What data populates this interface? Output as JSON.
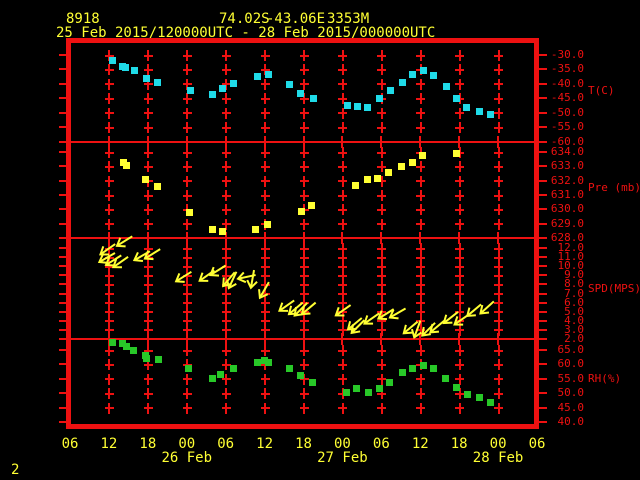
{
  "header": {
    "station_id": "8918",
    "latitude": "74.02S",
    "longitude": "-43.06E",
    "elevation": "3353M",
    "period": "25 Feb 2015/120000UTC - 28 Feb 2015/000000UTC"
  },
  "footer": {
    "page_number": "2"
  },
  "colors": {
    "background": "#000000",
    "frame": "#ee1111",
    "axis_text": "#ee1111",
    "header_text": "#ffff33",
    "temp_point": "#1fdbe8",
    "pressure_point": "#ffff33",
    "wind_arrow": "#ffff33",
    "rh_point": "#28c828"
  },
  "x_axis": {
    "time_note": "hours since 25 Feb 2015 00UTC",
    "start_hour": 6,
    "end_hour": 78,
    "tick_step_hours": 6,
    "hour_labels": [
      "06",
      "12",
      "18",
      "00",
      "06",
      "12",
      "18",
      "00",
      "06",
      "12",
      "18",
      "00",
      "06"
    ],
    "date_labels": [
      {
        "label": "26 Feb",
        "hour": 24
      },
      {
        "label": "27 Feb",
        "hour": 48
      },
      {
        "label": "28 Feb",
        "hour": 72
      }
    ]
  },
  "chart_data": [
    {
      "type": "scatter",
      "name": "temperature",
      "unit_label": "T(C)",
      "marker": "square",
      "color_key": "temp_point",
      "ylim": [
        -60,
        -30
      ],
      "yticks": [
        -30,
        -35,
        -40,
        -45,
        -50,
        -55,
        -60
      ],
      "points": [
        [
          12.5,
          -31.8
        ],
        [
          14.0,
          -33.7
        ],
        [
          14.5,
          -34.3
        ],
        [
          15.8,
          -35.2
        ],
        [
          17.7,
          -37.9
        ],
        [
          19.4,
          -39.5
        ],
        [
          24.5,
          -42.2
        ],
        [
          27.9,
          -43.5
        ],
        [
          29.5,
          -41.4
        ],
        [
          31.2,
          -39.8
        ],
        [
          34.9,
          -37.2
        ],
        [
          36.6,
          -36.7
        ],
        [
          39.7,
          -40.1
        ],
        [
          41.4,
          -43.3
        ],
        [
          43.4,
          -45.0
        ],
        [
          48.7,
          -47.4
        ],
        [
          50.3,
          -47.6
        ],
        [
          51.8,
          -47.9
        ],
        [
          53.7,
          -44.8
        ],
        [
          55.3,
          -42.2
        ],
        [
          57.2,
          -39.5
        ],
        [
          58.8,
          -36.6
        ],
        [
          60.4,
          -35.1
        ],
        [
          62.0,
          -36.9
        ],
        [
          64.0,
          -40.8
        ],
        [
          65.5,
          -45.0
        ],
        [
          67.1,
          -47.9
        ],
        [
          69.0,
          -49.4
        ],
        [
          70.8,
          -50.5
        ]
      ]
    },
    {
      "type": "scatter",
      "name": "pressure",
      "unit_label": "Pre (mb)",
      "marker": "square",
      "color_key": "pressure_point",
      "ylim": [
        628,
        634
      ],
      "yticks": [
        634,
        633,
        632,
        631,
        630,
        629,
        628
      ],
      "points": [
        [
          14.1,
          633.3
        ],
        [
          14.6,
          633.1
        ],
        [
          17.6,
          632.1
        ],
        [
          19.4,
          631.6
        ],
        [
          24.4,
          629.8
        ],
        [
          27.9,
          628.6
        ],
        [
          29.5,
          628.5
        ],
        [
          34.5,
          628.6
        ],
        [
          36.4,
          629.0
        ],
        [
          41.6,
          629.9
        ],
        [
          43.1,
          630.3
        ],
        [
          50.0,
          631.7
        ],
        [
          51.8,
          632.1
        ],
        [
          53.4,
          632.2
        ],
        [
          55.1,
          632.6
        ],
        [
          57.0,
          633.0
        ],
        [
          58.7,
          633.3
        ],
        [
          60.3,
          633.8
        ],
        [
          65.5,
          633.9
        ]
      ]
    },
    {
      "type": "wind_arrows",
      "name": "wind-speed",
      "unit_label": "SPD(MPS)",
      "marker": "arrow",
      "color_key": "wind_arrow",
      "ylim": [
        2,
        12
      ],
      "yticks": [
        12,
        11,
        10,
        9,
        8,
        7,
        6,
        5,
        4,
        3,
        2
      ],
      "points_note": "[hour, speed_mps, arrow_screen_angle_deg_cw_from_right]",
      "points": [
        [
          11.7,
          11.8,
          145
        ],
        [
          14.3,
          12.7,
          148
        ],
        [
          11.6,
          10.9,
          150
        ],
        [
          12.6,
          10.6,
          148
        ],
        [
          13.7,
          10.4,
          145
        ],
        [
          17.0,
          11.1,
          150
        ],
        [
          18.6,
          11.3,
          148
        ],
        [
          23.4,
          8.8,
          148
        ],
        [
          27.0,
          8.9,
          145
        ],
        [
          28.7,
          9.5,
          148
        ],
        [
          30.4,
          8.5,
          130
        ],
        [
          31.0,
          8.4,
          115
        ],
        [
          33.1,
          8.8,
          168
        ],
        [
          34.1,
          8.5,
          100
        ],
        [
          35.9,
          7.3,
          120
        ],
        [
          39.3,
          5.6,
          145
        ],
        [
          40.7,
          5.3,
          140
        ],
        [
          41.5,
          5.2,
          135
        ],
        [
          42.7,
          5.3,
          140
        ],
        [
          48.0,
          5.1,
          145
        ],
        [
          49.8,
          3.6,
          140
        ],
        [
          50.3,
          3.3,
          135
        ],
        [
          52.4,
          4.2,
          145
        ],
        [
          54.6,
          4.7,
          148
        ],
        [
          56.4,
          4.8,
          150
        ],
        [
          58.4,
          3.2,
          140
        ],
        [
          59.5,
          3.0,
          110
        ],
        [
          61.2,
          3.0,
          135
        ],
        [
          62.5,
          3.3,
          140
        ],
        [
          64.6,
          4.3,
          142
        ],
        [
          66.3,
          4.1,
          145
        ],
        [
          68.2,
          5.1,
          140
        ],
        [
          70.2,
          5.4,
          138
        ]
      ]
    },
    {
      "type": "scatter",
      "name": "relative-humidity",
      "unit_label": "RH(%)",
      "marker": "square",
      "color_key": "rh_point",
      "ylim": [
        40,
        65
      ],
      "yticks": [
        65,
        60,
        55,
        50,
        45,
        40
      ],
      "points": [
        [
          12.4,
          67.7
        ],
        [
          14.0,
          67.3
        ],
        [
          14.7,
          66.5
        ],
        [
          15.7,
          65.0
        ],
        [
          17.6,
          63.3
        ],
        [
          17.7,
          62.3
        ],
        [
          19.5,
          61.9
        ],
        [
          24.2,
          58.6
        ],
        [
          27.9,
          55.2
        ],
        [
          29.2,
          56.6
        ],
        [
          31.2,
          58.6
        ],
        [
          34.8,
          60.7
        ],
        [
          35.9,
          61.5
        ],
        [
          36.6,
          60.7
        ],
        [
          39.8,
          58.6
        ],
        [
          41.5,
          56.2
        ],
        [
          43.3,
          54.0
        ],
        [
          48.6,
          50.3
        ],
        [
          50.1,
          51.9
        ],
        [
          51.9,
          50.3
        ],
        [
          53.6,
          51.7
        ],
        [
          55.2,
          54.0
        ],
        [
          57.2,
          57.5
        ],
        [
          58.7,
          58.9
        ],
        [
          60.4,
          59.8
        ],
        [
          62.0,
          58.6
        ],
        [
          63.8,
          55.4
        ],
        [
          65.5,
          52.3
        ],
        [
          67.2,
          49.6
        ],
        [
          69.0,
          48.8
        ],
        [
          70.8,
          47.1
        ]
      ]
    }
  ]
}
